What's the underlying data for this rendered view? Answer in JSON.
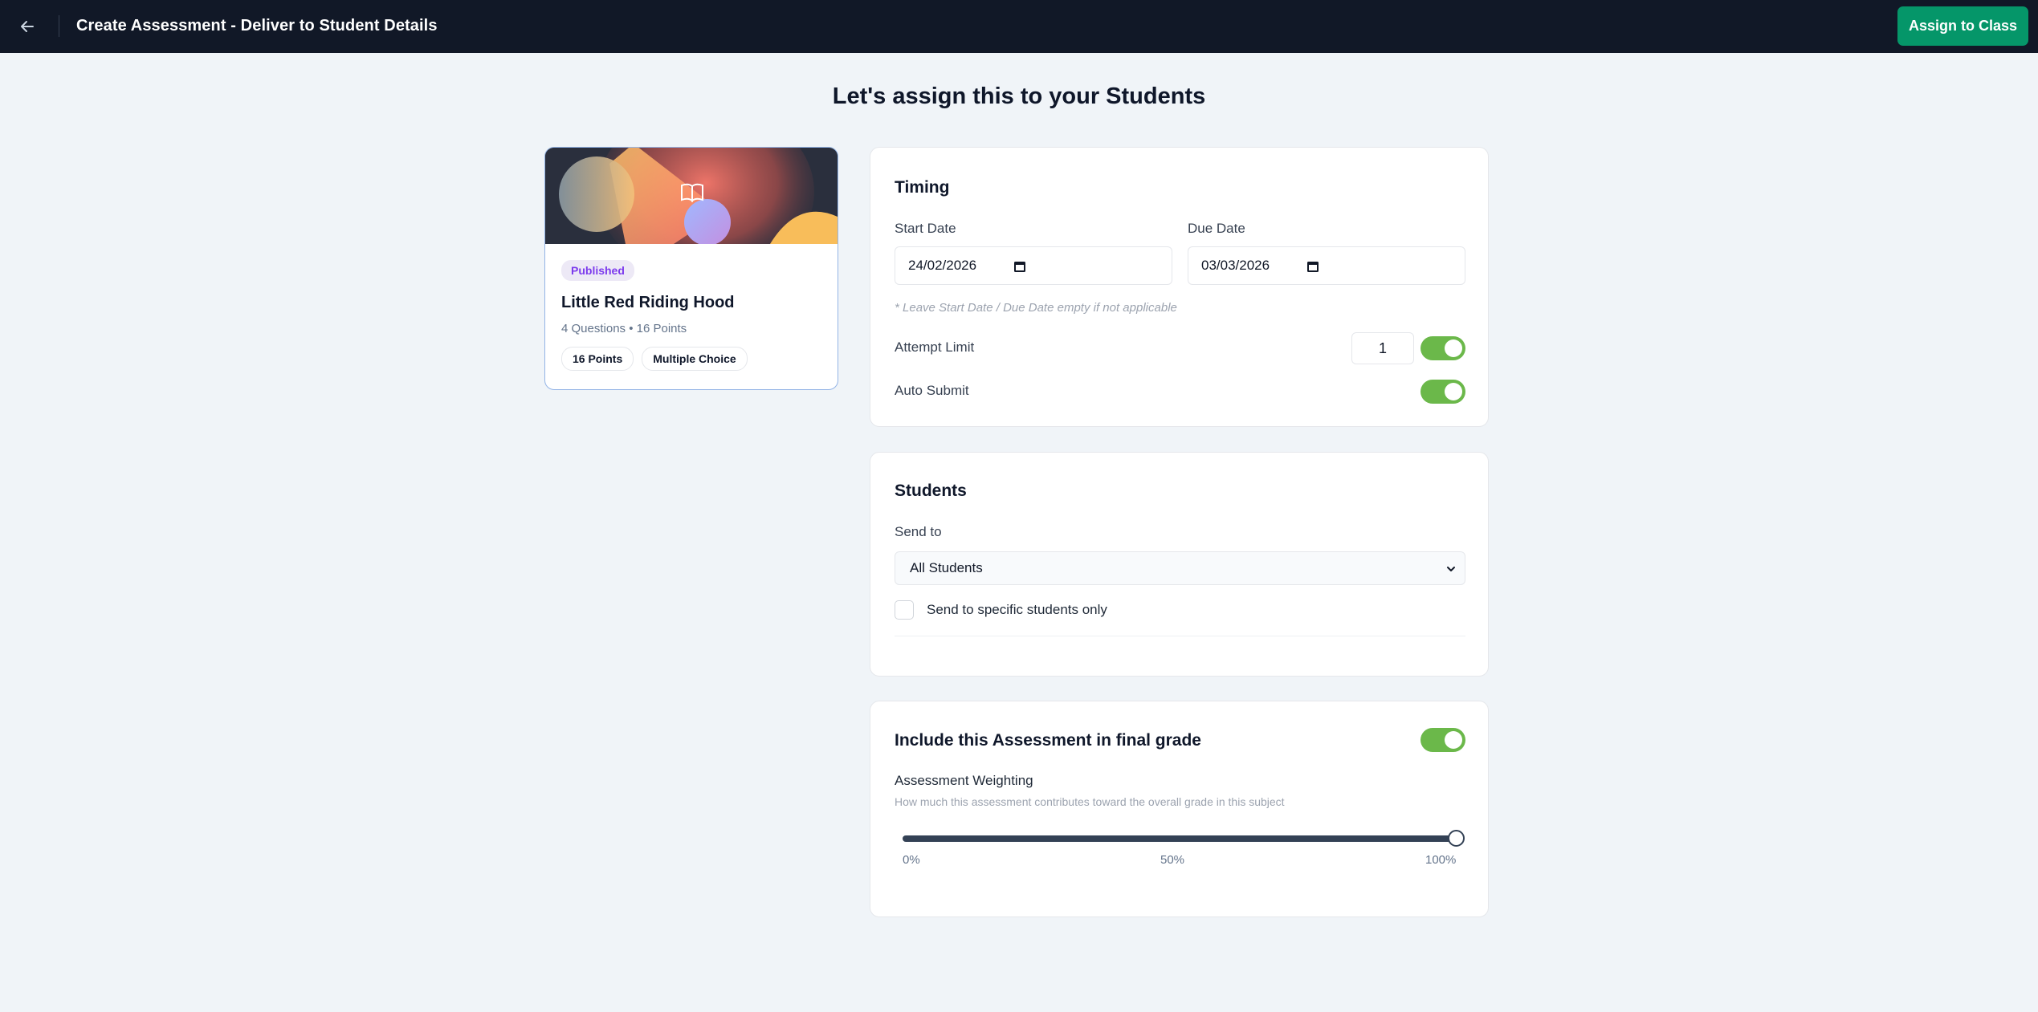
{
  "header": {
    "title": "Create Assessment - Deliver to Student Details",
    "assign_button": "Assign to Class"
  },
  "page": {
    "heading": "Let's assign this to your Students"
  },
  "assessment_card": {
    "status": "Published",
    "title": "Little Red Riding Hood",
    "meta": "4 Questions • 16 Points",
    "tags": [
      "16 Points",
      "Multiple Choice"
    ]
  },
  "timing": {
    "title": "Timing",
    "start_label": "Start Date",
    "start_value": "24/02/2026",
    "due_label": "Due Date",
    "due_value": "03/03/2026",
    "hint": "* Leave Start Date / Due Date empty if not applicable",
    "attempt_label": "Attempt Limit",
    "attempt_value": "1",
    "attempt_enabled": true,
    "auto_submit_label": "Auto Submit",
    "auto_submit_enabled": true
  },
  "students": {
    "title": "Students",
    "send_to_label": "Send to",
    "send_to_value": "All Students",
    "specific_label": "Send to specific students only",
    "specific_checked": false
  },
  "grading": {
    "title": "Include this Assessment in final grade",
    "include_enabled": true,
    "weighting_label": "Assessment Weighting",
    "weighting_desc": "How much this assessment contributes toward the overall grade in this subject",
    "weighting_percent": 100,
    "ticks": [
      "0%",
      "50%",
      "100%"
    ]
  },
  "colors": {
    "topbar": "#111827",
    "primary_button": "#059669",
    "toggle_on": "#6bb84a",
    "badge_text": "#7c3aed"
  }
}
